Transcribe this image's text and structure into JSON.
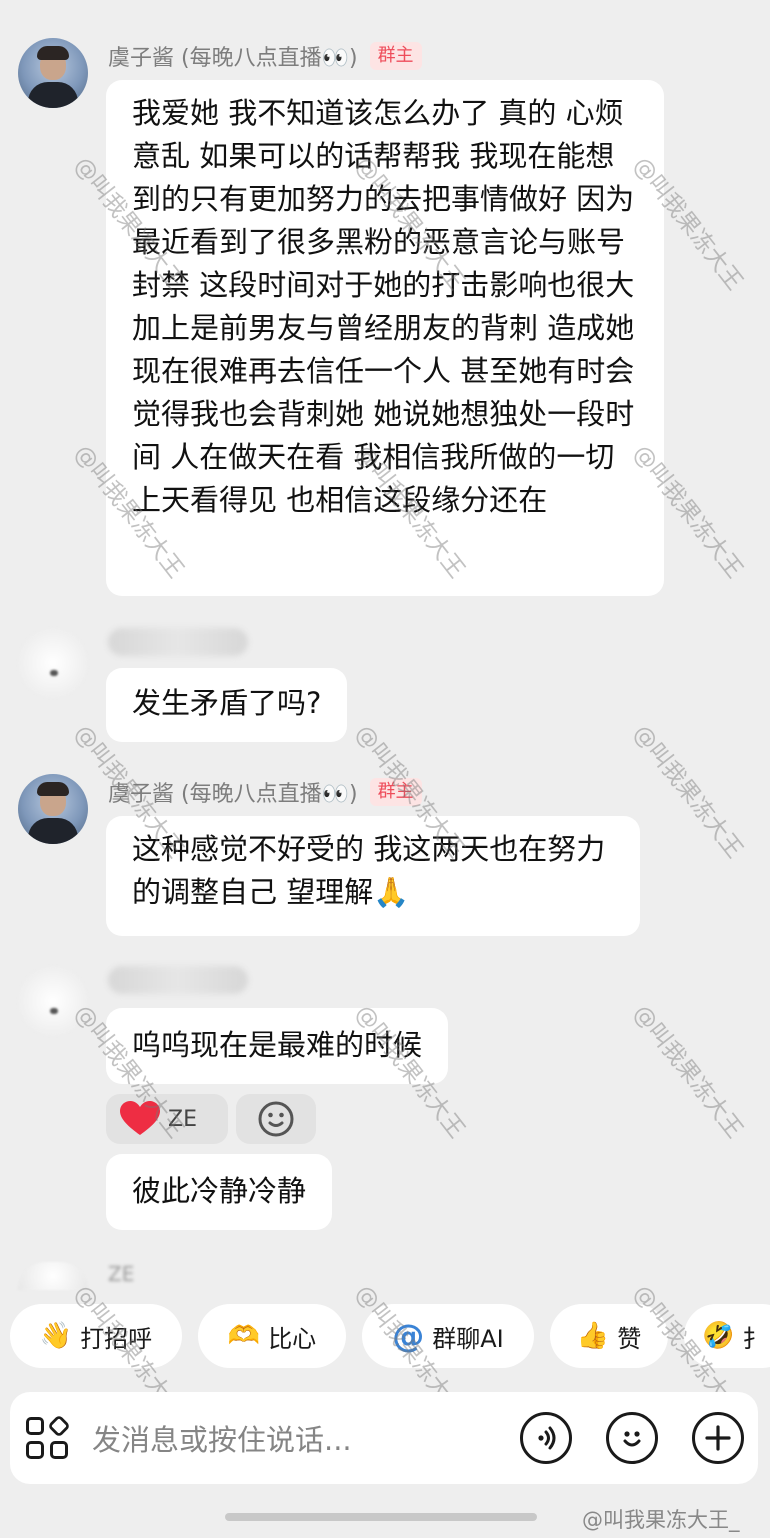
{
  "messages": [
    {
      "sender": "虞子酱 (每晚八点直播👀)",
      "badge": "群主",
      "text": "我爱她 我不知道该怎么办了 真的 心烦意乱 如果可以的话帮帮我 我现在能想到的只有更加努力的去把事情做好 因为最近看到了很多黑粉的恶意言论与账号封禁 这段时间对于她的打击影响也很大 加上是前男友与曾经朋友的背刺 造成她现在很难再去信任一个人 甚至她有时会觉得我也会背刺她 她说她想独处一段时间 人在做天在看 我相信我所做的一切上天看得见 也相信这段缘分还在"
    },
    {
      "text": "发生矛盾了吗?"
    },
    {
      "sender": "虞子酱 (每晚八点直播👀)",
      "badge": "群主",
      "text": "这种感觉不好受的 我这两天也在努力的调整自己 望理解🙏"
    },
    {
      "text": "呜呜现在是最难的时候"
    },
    {
      "text": "彼此冷静冷静"
    }
  ],
  "reactions": {
    "heart_user": "ZE",
    "heart_icon": "heart-icon",
    "add_icon": "smile-icon"
  },
  "partial_next_sender": "ZE",
  "quick_replies": [
    {
      "emoji": "👋",
      "label": "打招呼"
    },
    {
      "emoji": "🫶",
      "label": "比心"
    },
    {
      "emoji": "@",
      "label": "群聊AI"
    },
    {
      "emoji": "👍",
      "label": "赞"
    },
    {
      "emoji": "🤣",
      "label": "扌"
    }
  ],
  "input": {
    "placeholder": "发消息或按住说话...",
    "voice_icon": "voice-icon",
    "emoji_icon": "emoji-icon",
    "plus_icon": "plus-icon",
    "apps_icon": "apps-grid-icon"
  },
  "watermark": "@叫我果冻大王",
  "corner_watermark": "@叫我果冻大王_",
  "colors": {
    "background": "#eeeeee",
    "bubble": "#ffffff",
    "badge_bg": "#fde4e4",
    "badge_text": "#ee4d5b",
    "heart": "#ee2d43"
  }
}
